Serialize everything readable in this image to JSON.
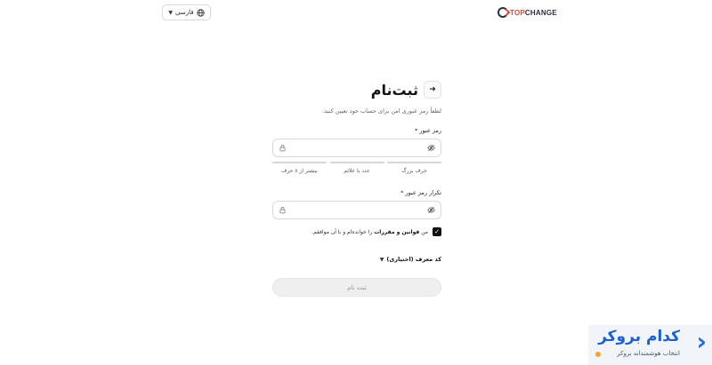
{
  "header": {
    "language_label": "فارسی",
    "logo_top": "TOP",
    "logo_change": "CHANGE"
  },
  "form": {
    "title": "ثبت‌نام",
    "subtitle": "لطفاً رمز عبوری امن برای حساب خود تعیین کنید.",
    "password_label": "رمز عبور",
    "required_mark": "*",
    "password_value": "",
    "rules": [
      "حرف بزرگ",
      "عدد یا علائم",
      "بیشتر از ۸ حرف"
    ],
    "confirm_label": "تکرار رمز عبور",
    "confirm_value": "",
    "terms_prefix": "من",
    "terms_link": "قوانین و مقررات",
    "terms_suffix": "را خوانده‌ام و با آن موافقم.",
    "terms_checked": true,
    "referral_label": "کد معرف (اختیاری)",
    "submit_label": "ثبت نام"
  },
  "watermark": {
    "title": "کدام بروکر",
    "subtitle": "انتخاب هوشمندانه بروکر"
  },
  "colors": {
    "accent_red": "#e0452f",
    "brand_dark": "#2b2f3a",
    "watermark_blue": "#1c6ae4"
  }
}
